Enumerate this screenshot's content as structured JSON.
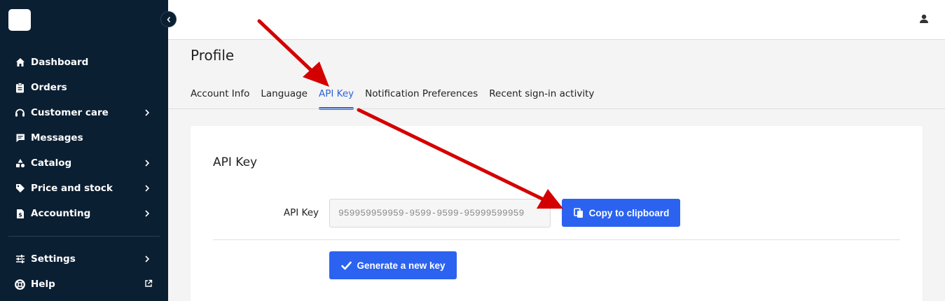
{
  "sidebar": {
    "items": [
      {
        "label": "Dashboard",
        "icon": "home-icon",
        "has_chevron": false
      },
      {
        "label": "Orders",
        "icon": "clipboard-icon",
        "has_chevron": false
      },
      {
        "label": "Customer care",
        "icon": "headset-icon",
        "has_chevron": true
      },
      {
        "label": "Messages",
        "icon": "message-icon",
        "has_chevron": false
      },
      {
        "label": "Catalog",
        "icon": "shapes-icon",
        "has_chevron": true
      },
      {
        "label": "Price and stock",
        "icon": "tag-icon",
        "has_chevron": true
      },
      {
        "label": "Accounting",
        "icon": "invoice-icon",
        "has_chevron": true
      }
    ],
    "bottom_items": [
      {
        "label": "Settings",
        "icon": "sliders-icon",
        "has_chevron": true
      },
      {
        "label": "Help",
        "icon": "lifebuoy-icon",
        "external": true
      }
    ]
  },
  "page": {
    "title": "Profile"
  },
  "tabs": [
    {
      "label": "Account Info",
      "active": false
    },
    {
      "label": "Language",
      "active": false
    },
    {
      "label": "API Key",
      "active": true
    },
    {
      "label": "Notification Preferences",
      "active": false
    },
    {
      "label": "Recent sign-in activity",
      "active": false
    }
  ],
  "api_card": {
    "title": "API Key",
    "field_label": "API Key",
    "key_placeholder": "959959959959-9599-9599-95999599959",
    "copy_label": "Copy to clipboard",
    "generate_label": "Generate a new key"
  },
  "colors": {
    "sidebar_bg": "#0b1f33",
    "accent": "#2b63f0",
    "annotation_arrow": "#d40000"
  }
}
